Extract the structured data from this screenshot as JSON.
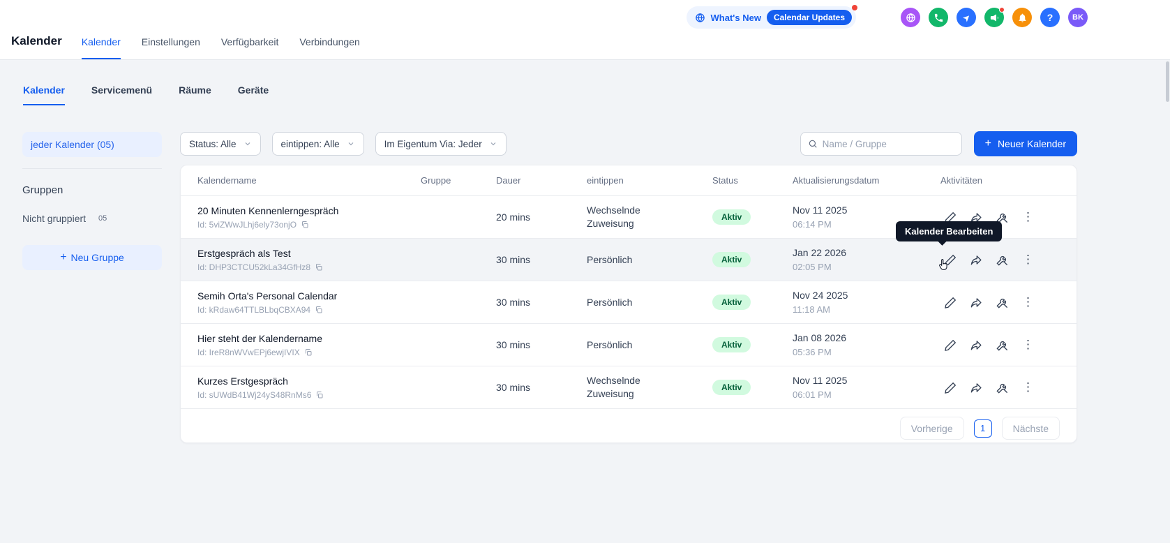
{
  "topbar": {
    "whats_new_label": "What's New",
    "calendar_updates_label": "Calendar Updates",
    "avatar_initials": "BK"
  },
  "header": {
    "title": "Kalender",
    "tabs": [
      "Kalender",
      "Einstellungen",
      "Verfügbarkeit",
      "Verbindungen"
    ]
  },
  "subtabs": [
    "Kalender",
    "Servicemenü",
    "Räume",
    "Geräte"
  ],
  "sidebar": {
    "all_calendars_label": "jeder Kalender (05)",
    "groups_heading": "Gruppen",
    "ungrouped_label": "Nicht gruppiert",
    "ungrouped_count": "05",
    "new_group_label": "Neu Gruppe"
  },
  "filters": {
    "status": "Status: Alle",
    "type": "eintippen: Alle",
    "owned_by": "Im Eigentum Via: Jeder",
    "search_placeholder": "Name / Gruppe",
    "new_calendar_label": "Neuer Kalender"
  },
  "table": {
    "columns": [
      "Kalendername",
      "Gruppe",
      "Dauer",
      "eintippen",
      "Status",
      "Aktualisierungsdatum",
      "Aktivitäten"
    ],
    "rows": [
      {
        "name": "20 Minuten Kennenlerngespräch",
        "id": "Id: 5viZWwJLhj6ely73onjO",
        "gruppe": "",
        "dauer": "20 mins",
        "eintippen": "Wechselnde Zuweisung",
        "status": "Aktiv",
        "date": "Nov 11 2025",
        "time": "06:14 PM"
      },
      {
        "name": "Erstgespräch als Test",
        "id": "Id: DHP3CTCU52kLa34GfHz8",
        "gruppe": "",
        "dauer": "30 mins",
        "eintippen": "Persönlich",
        "status": "Aktiv",
        "date": "Jan 22 2026",
        "time": "02:05 PM"
      },
      {
        "name": "Semih Orta's Personal Calendar",
        "id": "Id: kRdaw64TTLBLbqCBXA94",
        "gruppe": "",
        "dauer": "30 mins",
        "eintippen": "Persönlich",
        "status": "Aktiv",
        "date": "Nov 24 2025",
        "time": "11:18 AM"
      },
      {
        "name": "Hier steht der Kalendername",
        "id": "Id: IreR8nWVwEPj6ewjIVIX",
        "gruppe": "",
        "dauer": "30 mins",
        "eintippen": "Persönlich",
        "status": "Aktiv",
        "date": "Jan 08 2026",
        "time": "05:36 PM"
      },
      {
        "name": "Kurzes Erstgespräch",
        "id": "Id: sUWdB41Wj24yS48RnMs6",
        "gruppe": "",
        "dauer": "30 mins",
        "eintippen": "Wechselnde Zuweisung",
        "status": "Aktiv",
        "date": "Nov 11 2025",
        "time": "06:01 PM"
      }
    ]
  },
  "tooltip": {
    "edit_calendar": "Kalender Bearbeiten"
  },
  "pagination": {
    "prev": "Vorherige",
    "page": "1",
    "next": "Nächste"
  },
  "icons": {
    "plus": "+",
    "kebab": "⋮",
    "help": "?"
  },
  "colors": {
    "accent": "#155eef",
    "active_badge_bg": "#d1fadf",
    "active_badge_text": "#05603a",
    "alert": "#f04438"
  }
}
